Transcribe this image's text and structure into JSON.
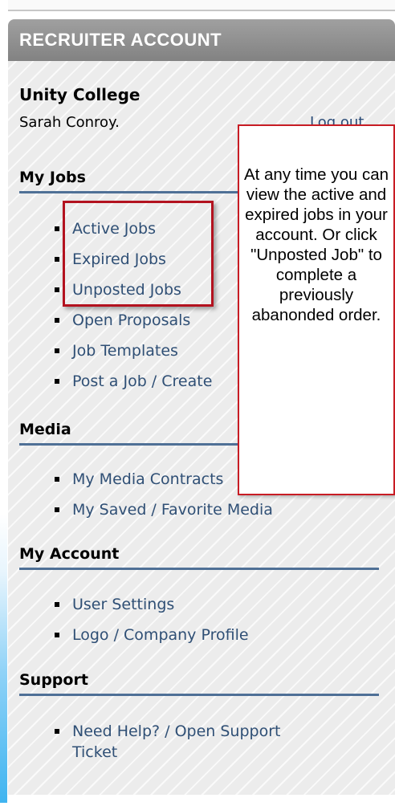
{
  "panel": {
    "title": "RECRUITER ACCOUNT"
  },
  "account": {
    "company": "Unity College",
    "user": "Sarah Conroy.",
    "logout_label": "Log out"
  },
  "sections": {
    "my_jobs": {
      "title": "My Jobs",
      "items": [
        "Active Jobs",
        "Expired Jobs",
        "Unposted Jobs",
        "Open Proposals",
        "Job Templates",
        "Post a Job / Create"
      ]
    },
    "media": {
      "title": "Media",
      "items": [
        "My Media Contracts",
        "My Saved / Favorite Media"
      ]
    },
    "my_account": {
      "title": "My Account",
      "items": [
        "User Settings",
        "Logo / Company Profile"
      ]
    },
    "support": {
      "title": "Support",
      "items": [
        "Need Help? / Open Support Ticket"
      ]
    }
  },
  "callout": {
    "text": "At any time you can view the active and expired jobs in your account. Or click \"Unposted Job\" to complete a previously abanonded order."
  },
  "colors": {
    "header_bg": "#8f8f8f",
    "link": "#2f4f75",
    "section_rule": "#4f7096",
    "callout_border": "#c81c24",
    "highlight_border": "#b3121f"
  }
}
